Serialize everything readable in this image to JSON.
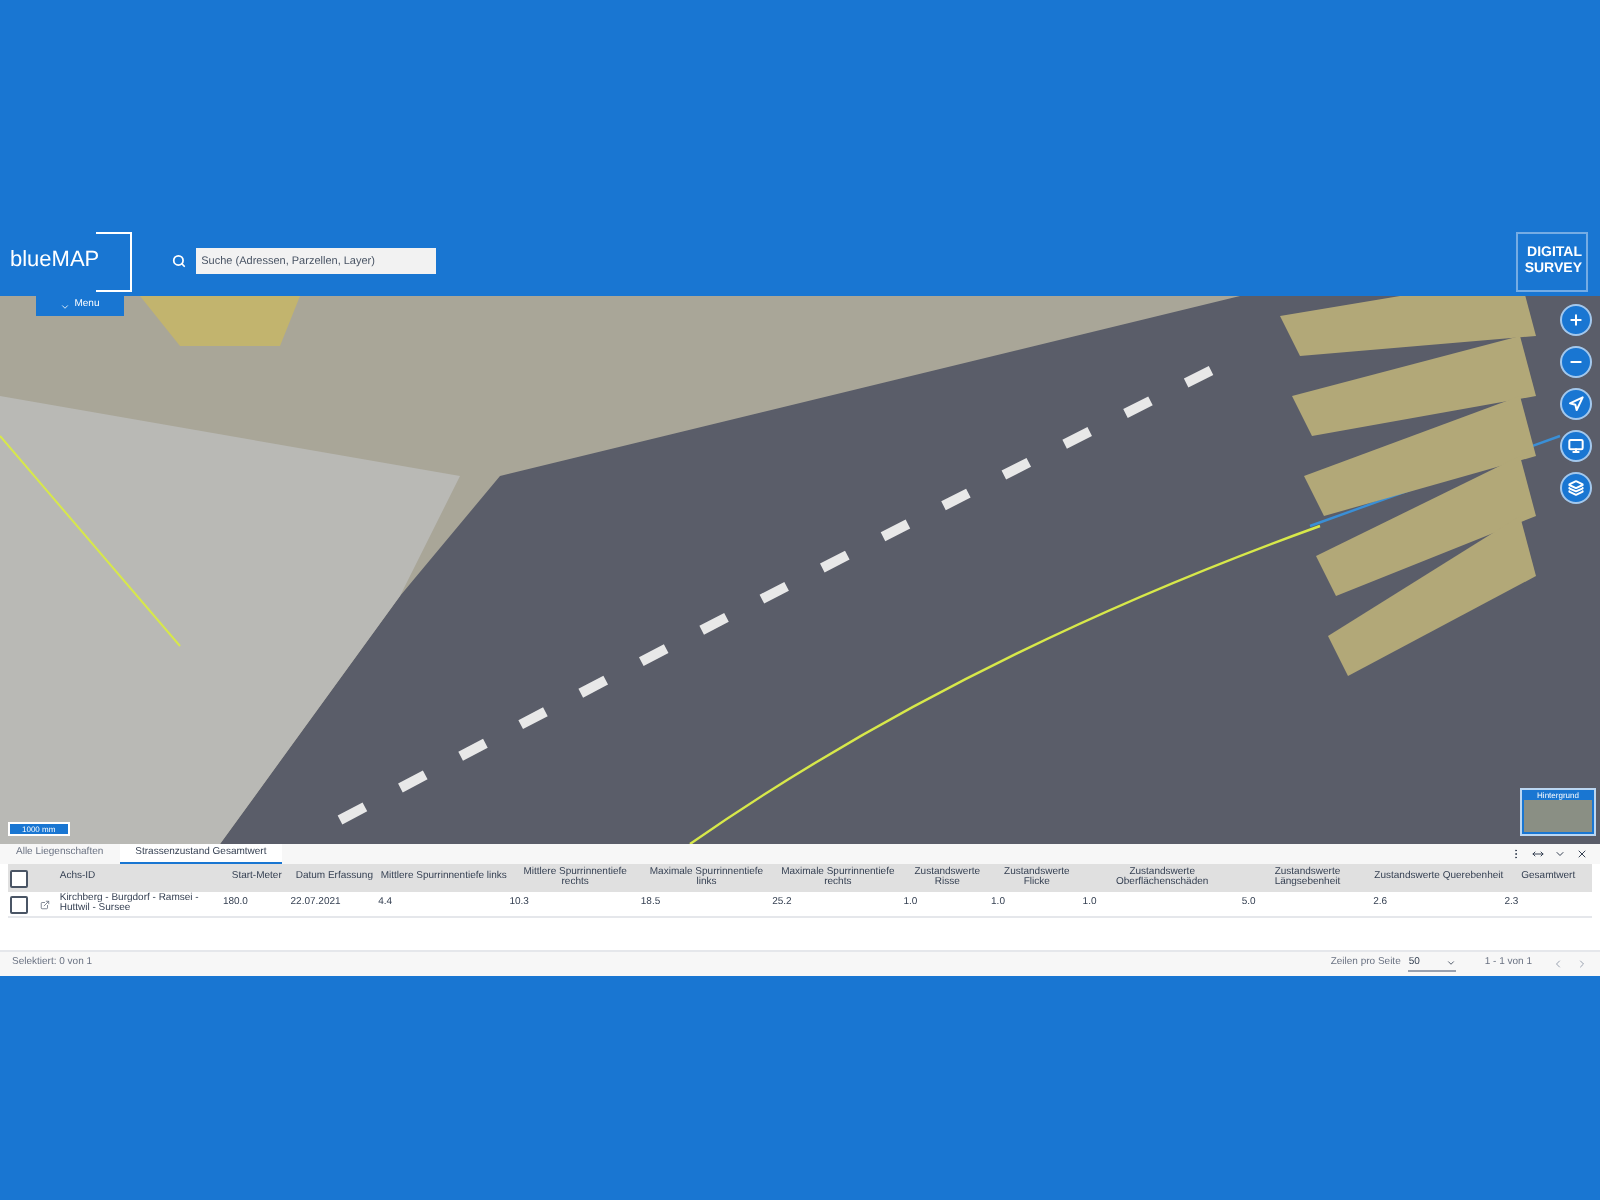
{
  "header": {
    "logo": "blueMAP",
    "search": {
      "placeholder": "Suche (Adressen, Parzellen, Layer)"
    },
    "brand": [
      "DIGITAL",
      "SURVEY"
    ],
    "menu": "Menu"
  },
  "map": {
    "scale": "1000 mm",
    "basemap": "Hintergrund"
  },
  "map_controls": [
    {
      "kind": "plus"
    },
    {
      "kind": "minus"
    },
    {
      "kind": "north"
    },
    {
      "kind": "screen"
    },
    {
      "kind": "layers"
    }
  ],
  "panel": {
    "tabs": [
      {
        "label": "Alle Liegenschaften",
        "selected": false
      },
      {
        "label": "Strassenzustand Gesamtwert",
        "selected": true
      }
    ],
    "table": {
      "header_checked": false,
      "columns": [
        "Achs-ID",
        "Start-Meter",
        "Datum Erfassung",
        "Mittlere Spurrinnentiefe links",
        "Mittlere Spurrinnentiefe rechts",
        "Maximale Spurrinnentiefe links",
        "Maximale Spurrinnentiefe rechts",
        "Zustandswerte Risse",
        "Zustandswerte Flicke",
        "Zustandswerte Oberflächenschäden",
        "Zustandswerte Längsebenheit",
        "Zustandswerte Querebenheit",
        "Gesamtwert"
      ],
      "rows": [
        {
          "checked": false,
          "cells": [
            "Kirchberg - Burgdorf - Ramsei - Huttwil - Sursee",
            "180.0",
            "22.07.2021",
            "4.4",
            "10.3",
            "18.5",
            "25.2",
            "1.0",
            "1.0",
            "1.0",
            "5.0",
            "2.6",
            "2.3"
          ]
        }
      ]
    },
    "selected_count": "Selektiert: 0 von 1",
    "rows_per_page_label": "Zeilen pro Seite",
    "rows_per_page": "50",
    "range": "1 - 1 von 1"
  }
}
